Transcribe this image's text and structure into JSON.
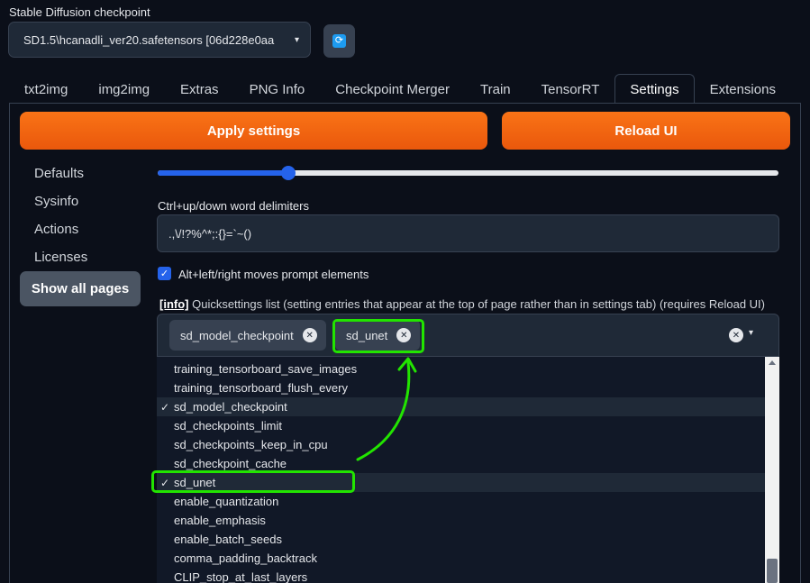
{
  "checkpoint": {
    "label": "Stable Diffusion checkpoint",
    "value": "SD1.5\\hcanadli_ver20.safetensors [06d228e0aa"
  },
  "tabs": [
    {
      "label": "txt2img",
      "active": false
    },
    {
      "label": "img2img",
      "active": false
    },
    {
      "label": "Extras",
      "active": false
    },
    {
      "label": "PNG Info",
      "active": false
    },
    {
      "label": "Checkpoint Merger",
      "active": false
    },
    {
      "label": "Train",
      "active": false
    },
    {
      "label": "TensorRT",
      "active": false
    },
    {
      "label": "Settings",
      "active": true
    },
    {
      "label": "Extensions",
      "active": false
    }
  ],
  "buttons": {
    "apply": "Apply settings",
    "reload": "Reload UI"
  },
  "sidebar": {
    "items": [
      {
        "label": "Defaults"
      },
      {
        "label": "Sysinfo"
      },
      {
        "label": "Actions"
      },
      {
        "label": "Licenses"
      }
    ],
    "show_all": "Show all pages"
  },
  "slider": {
    "fraction": 0.21
  },
  "delimiters": {
    "label": "Ctrl+up/down word delimiters",
    "value": ".,\\/!?%^*;:{}=`~()"
  },
  "checkbox": {
    "checked": true,
    "label": "Alt+left/right moves prompt elements"
  },
  "quicksettings": {
    "info": "[info]",
    "label": " Quicksettings list (setting entries that appear at the top of page rather than in settings tab) (requires Reload UI)",
    "tokens": [
      "sd_model_checkpoint",
      "sd_unet"
    ],
    "options": [
      {
        "label": "training_tensorboard_save_images",
        "selected": false
      },
      {
        "label": "training_tensorboard_flush_every",
        "selected": false
      },
      {
        "label": "sd_model_checkpoint",
        "selected": true
      },
      {
        "label": "sd_checkpoints_limit",
        "selected": false
      },
      {
        "label": "sd_checkpoints_keep_in_cpu",
        "selected": false
      },
      {
        "label": "sd_checkpoint_cache",
        "selected": false
      },
      {
        "label": "sd_unet",
        "selected": true
      },
      {
        "label": "enable_quantization",
        "selected": false
      },
      {
        "label": "enable_emphasis",
        "selected": false
      },
      {
        "label": "enable_batch_seeds",
        "selected": false
      },
      {
        "label": "comma_padding_backtrack",
        "selected": false
      },
      {
        "label": "CLIP_stop_at_last_layers",
        "selected": false
      }
    ]
  },
  "icons": {
    "caret": "▾",
    "refresh": "⟳",
    "check": "✓",
    "close": "✕"
  },
  "colors": {
    "accent_orange": "#f97316",
    "accent_blue": "#2563eb",
    "highlight_green": "#22e400",
    "background": "#0b0f19"
  }
}
